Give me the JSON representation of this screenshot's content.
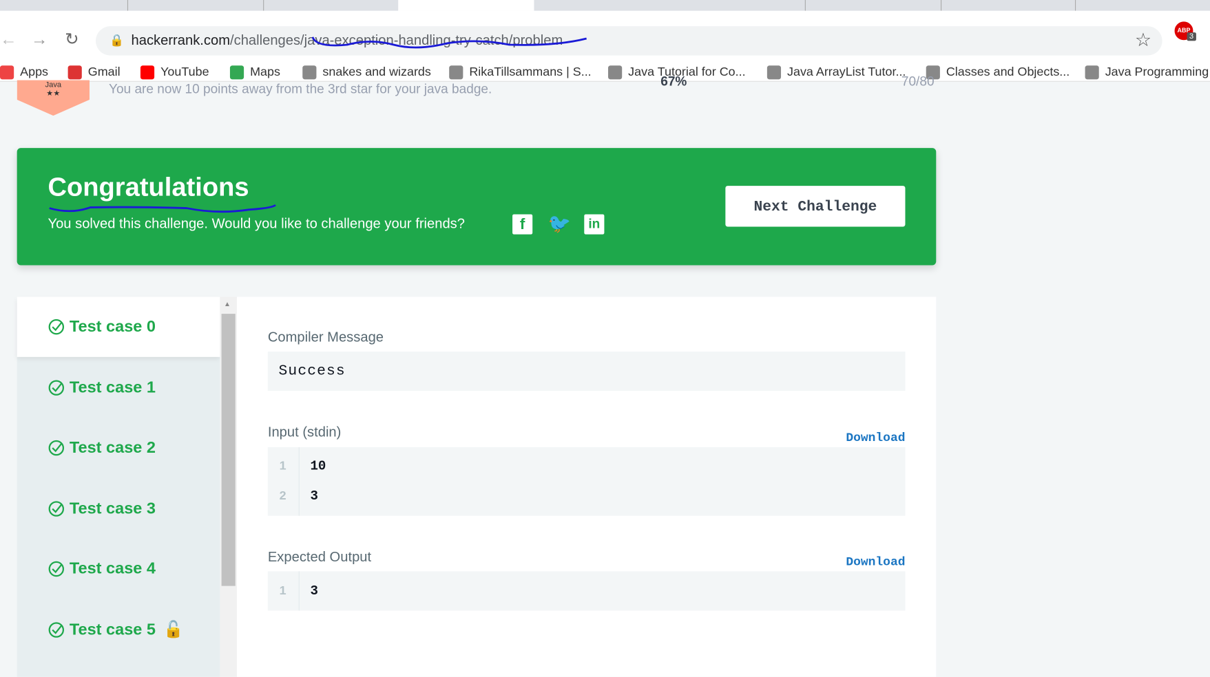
{
  "browser": {
    "url_host": "hackerrank.com",
    "url_path": "/challenges/java-exception-handling-try-catch/problem",
    "bookmarks": [
      {
        "label": "Apps",
        "icon": "apps-grid-icon"
      },
      {
        "label": "Gmail",
        "icon": "gmail-icon"
      },
      {
        "label": "YouTube",
        "icon": "youtube-icon"
      },
      {
        "label": "Maps",
        "icon": "maps-icon"
      },
      {
        "label": "snakes and wizards",
        "icon": "bookmark-icon"
      },
      {
        "label": "RikaTillsammans | S...",
        "icon": "bookmark-icon"
      },
      {
        "label": "Java Tutorial for Co...",
        "icon": "bookmark-icon"
      },
      {
        "label": "Java ArrayList Tutor...",
        "icon": "bookmark-icon"
      },
      {
        "label": "Classes and Objects...",
        "icon": "bookmark-icon"
      },
      {
        "label": "Java Programming",
        "icon": "bookmark-icon"
      }
    ],
    "extension_badge": "3"
  },
  "badge": {
    "name": "Java",
    "stars": "★★",
    "message": "You are now 10 points away from the 3rd star for your java badge.",
    "percent": "67%",
    "score": "70/80"
  },
  "banner": {
    "title": "Congratulations",
    "subtitle": "You solved this challenge. Would you like to challenge your friends?",
    "next_label": "Next Challenge",
    "color": "#1ea84b"
  },
  "testcases": [
    "Test case 0",
    "Test case 1",
    "Test case 2",
    "Test case 3",
    "Test case 4",
    "Test case 5"
  ],
  "result": {
    "compiler_label": "Compiler Message",
    "compiler_value": "Success",
    "input_label": "Input (stdin)",
    "input_lines": [
      "10",
      "3"
    ],
    "expected_label": "Expected Output",
    "expected_lines": [
      "3"
    ],
    "download_label": "Download"
  }
}
